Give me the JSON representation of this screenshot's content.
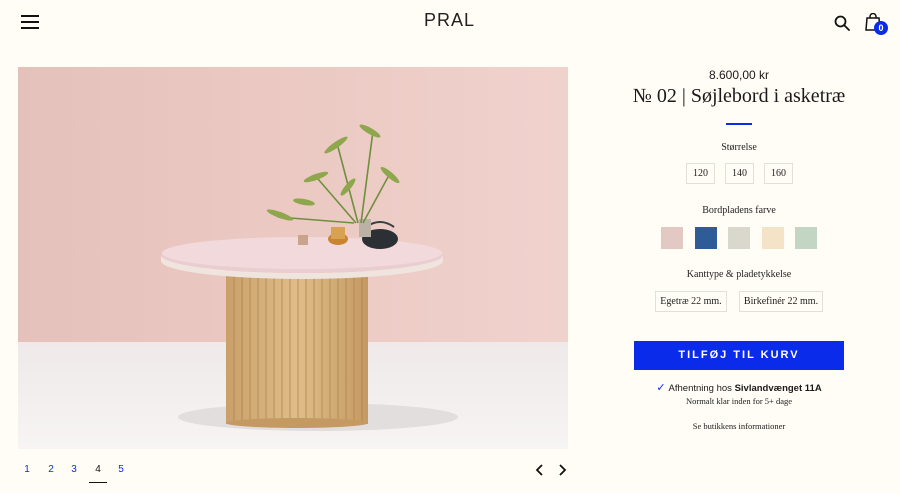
{
  "header": {
    "logo": "PRAL",
    "menu_icon": "hamburger-icon",
    "search_icon": "search-icon",
    "cart_icon": "bag-icon",
    "cart_count": "0"
  },
  "product": {
    "price": "8.600,00 kr",
    "title": "№ 02 | Søjlebord i asketræ",
    "size_label": "Størrelse",
    "sizes": [
      "120",
      "140",
      "160"
    ],
    "color_label": "Bordpladens farve",
    "colors": [
      "#e2c9c3",
      "#2d5c96",
      "#d9d8cd",
      "#f4e3c7",
      "#c3d6c3"
    ],
    "edge_label": "Kanttype & pladetykkelse",
    "edges": [
      "Egetræ 22 mm.",
      "Birkefinér 22 mm."
    ],
    "add_to_cart": "TILFØJ TIL KURV",
    "pickup_prefix": "Afhentning hos",
    "pickup_location": "Sivlandvænget 11A",
    "ready_note": "Normalt klar inden for 5+ dage",
    "store_info": "Se butikkens informationer"
  },
  "gallery": {
    "pages": [
      "1",
      "2",
      "3",
      "4",
      "5"
    ],
    "active_page": "4",
    "prev_icon": "chevron-left-icon",
    "next_icon": "chevron-right-icon"
  },
  "colors": {
    "accent": "#0b2bea",
    "background": "#fffdf6"
  }
}
